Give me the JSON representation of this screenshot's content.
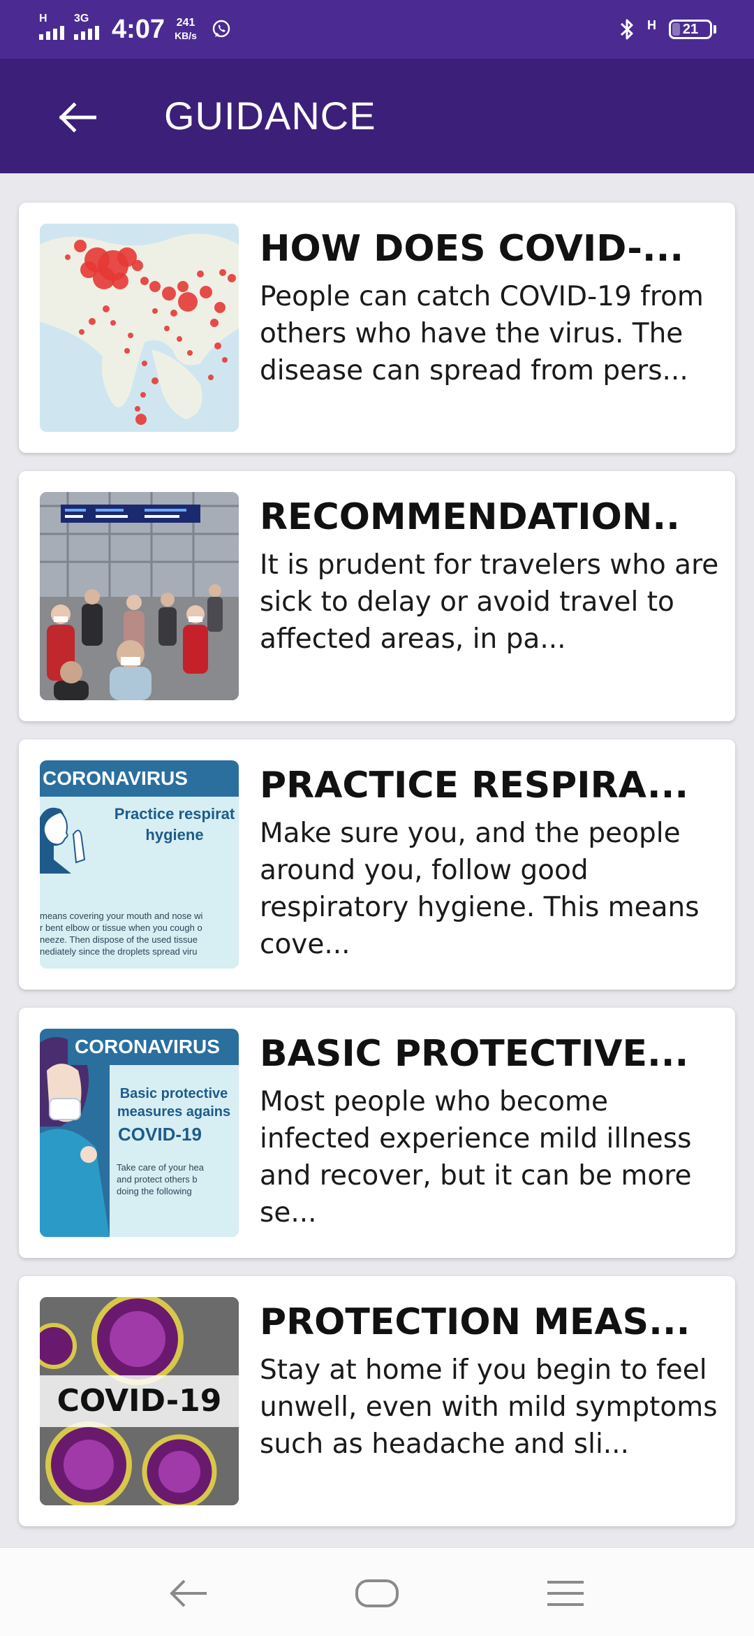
{
  "status_bar": {
    "signal1_label": "H",
    "signal2_label": "3G",
    "time": "4:07",
    "speed_value": "241",
    "speed_unit": "KB/s",
    "network_label": "H",
    "battery_level": "21",
    "icons": [
      "whatsapp-icon",
      "bluetooth-icon"
    ]
  },
  "app_bar": {
    "title": "GUIDANCE",
    "back_icon": "arrow-left-icon"
  },
  "cards": [
    {
      "title": "HOW DOES COVID-...",
      "text": "People can catch COVID-19 from others who have the virus. The disease can spread from pers...",
      "image": "world-map-cases"
    },
    {
      "title": "RECOMMENDATION..",
      "text": "It is prudent for travelers who are sick to delay or avoid travel to affected areas, in pa...",
      "image": "airport-travelers-masks"
    },
    {
      "title": "PRACTICE RESPIRA...",
      "text": "Make sure you, and the people around you, follow good respiratory hygiene. This means cove...",
      "image": "respiratory-hygiene-poster",
      "thumb": {
        "banner": "CORONAVIRUS",
        "heading": "Practice respirat hygiene",
        "small_lines": [
          "means covering your mouth and nose wi",
          "r bent elbow or tissue when you cough o",
          "neeze. Then dispose of the used tissue",
          "nediately since the droplets spread viru"
        ]
      }
    },
    {
      "title": "BASIC PROTECTIVE...",
      "text": "Most people who become infected experience mild illness and recover, but it can be more se...",
      "image": "protective-measures-poster",
      "thumb": {
        "banner": "CORONAVIRUS",
        "heading": "Basic protective measures agains",
        "heading2": "COVID-19",
        "small_lines": [
          "Take care of your hea",
          "and protect others b",
          "doing the following"
        ]
      }
    },
    {
      "title": "PROTECTION MEAS...",
      "text": "Stay at home if you begin to feel unwell, even with mild symptoms such as headache and sli...",
      "image": "coronavirus-microscope",
      "thumb": {
        "label": "COVID-19"
      }
    }
  ],
  "nav_bar": {
    "buttons": [
      "back-nav-icon",
      "home-nav-icon",
      "menu-nav-icon"
    ]
  },
  "colors": {
    "status_bar": "#4b2b92",
    "app_bar": "#3c1f78",
    "background": "#e9e8ed",
    "card": "#ffffff",
    "map_dots": "#e53935"
  }
}
